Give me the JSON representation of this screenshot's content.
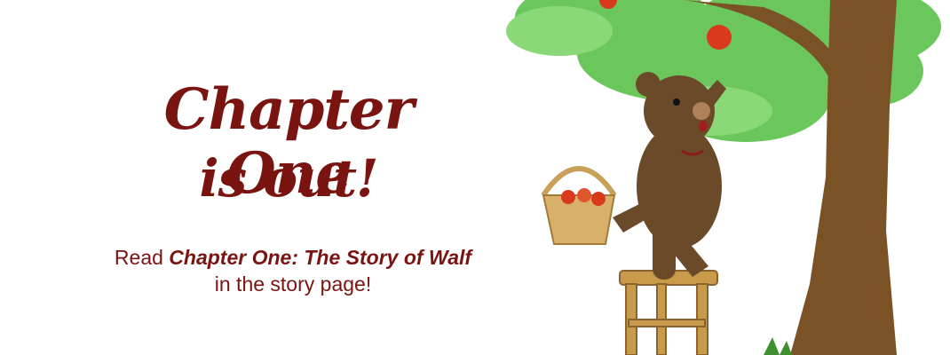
{
  "banner": {
    "headline_line1": "Chapter One",
    "headline_line2": "is out!",
    "sub_prefix": "Read ",
    "sub_title": "Chapter One: The Story of Walf",
    "sub_line2": "in the story page!"
  },
  "colors": {
    "text": "#7a1411",
    "foliage": "#5cc24a",
    "trunk": "#7a5226",
    "bear": "#6b4a2a",
    "apple": "#d93a1e",
    "stool": "#c99a4a"
  },
  "illustration": {
    "icon": "bear-picking-apples-illustration"
  }
}
